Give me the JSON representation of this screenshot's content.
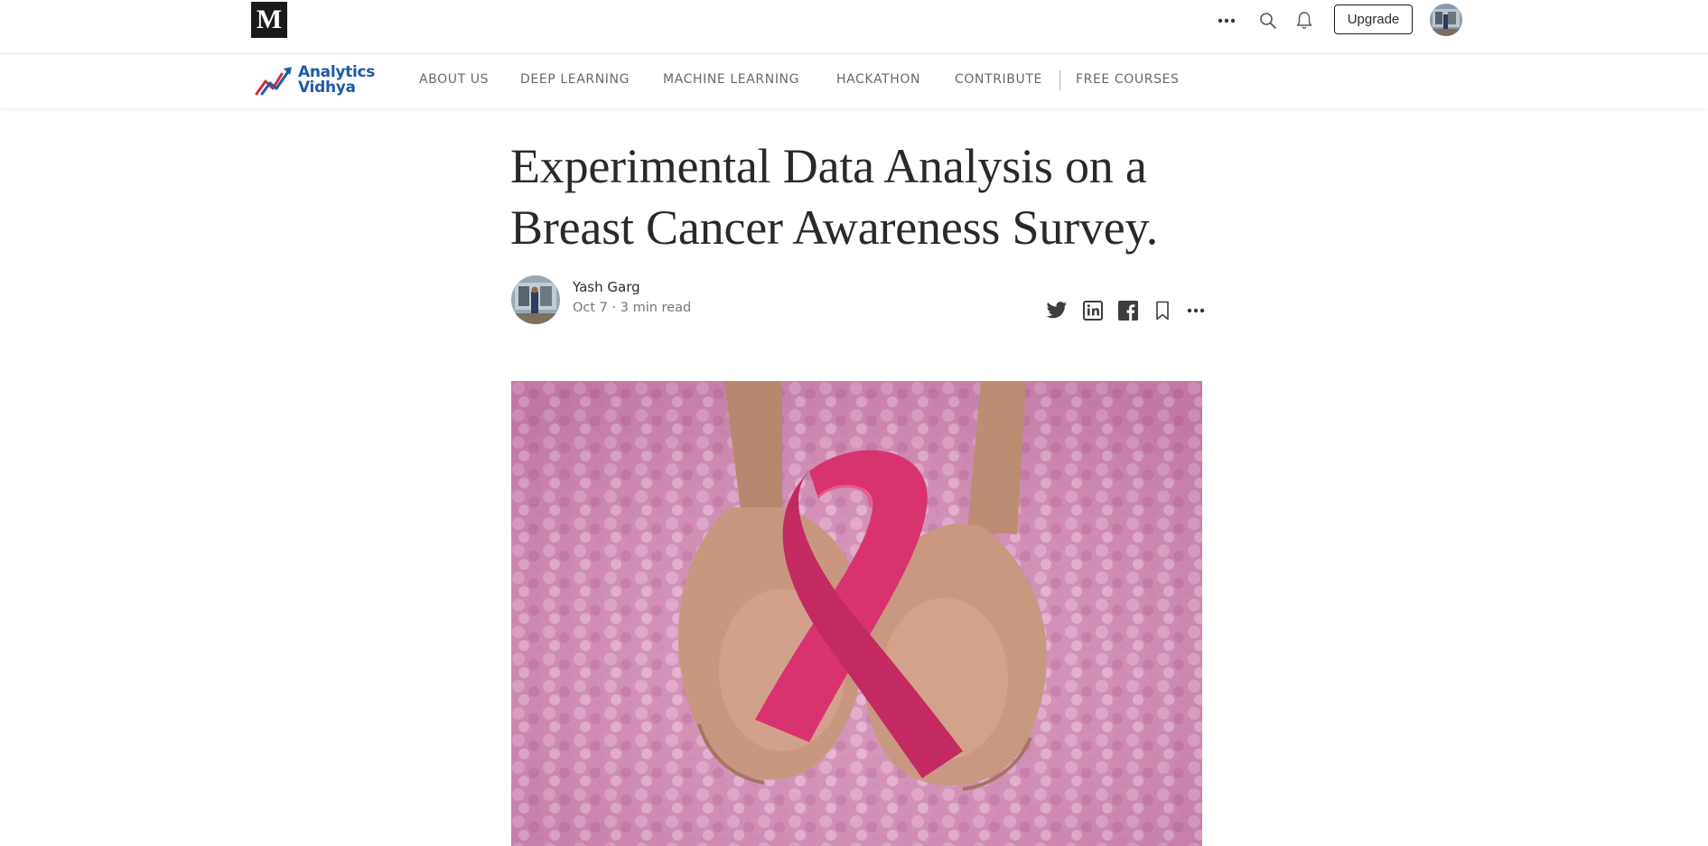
{
  "topbar": {
    "logo_letter": "M",
    "icons": [
      "more-horizontal-icon",
      "search-icon",
      "bell-icon"
    ],
    "upgrade_label": "Upgrade"
  },
  "publication": {
    "logo_line1": "Analytics",
    "logo_line2": "Vidhya",
    "brand_colors": {
      "blue": "#1d5ba6",
      "red": "#d8283c"
    },
    "nav": [
      "ABOUT US",
      "DEEP LEARNING",
      "MACHINE LEARNING",
      "HACKATHON",
      "CONTRIBUTE",
      "FREE COURSES"
    ]
  },
  "article": {
    "title_line1": "Experimental Data Analysis on a",
    "title_line2": "Breast Cancer Awareness Survey.",
    "author": "Yash Garg",
    "meta": "Oct 7 · 3 min read",
    "share_icons": [
      "twitter-icon",
      "linkedin-icon",
      "facebook-icon",
      "bookmark-icon",
      "more-horizontal-icon"
    ],
    "hero_colors": {
      "background": "#d890b8",
      "ribbon": "#d8336f",
      "skin": "#c9977f"
    }
  }
}
